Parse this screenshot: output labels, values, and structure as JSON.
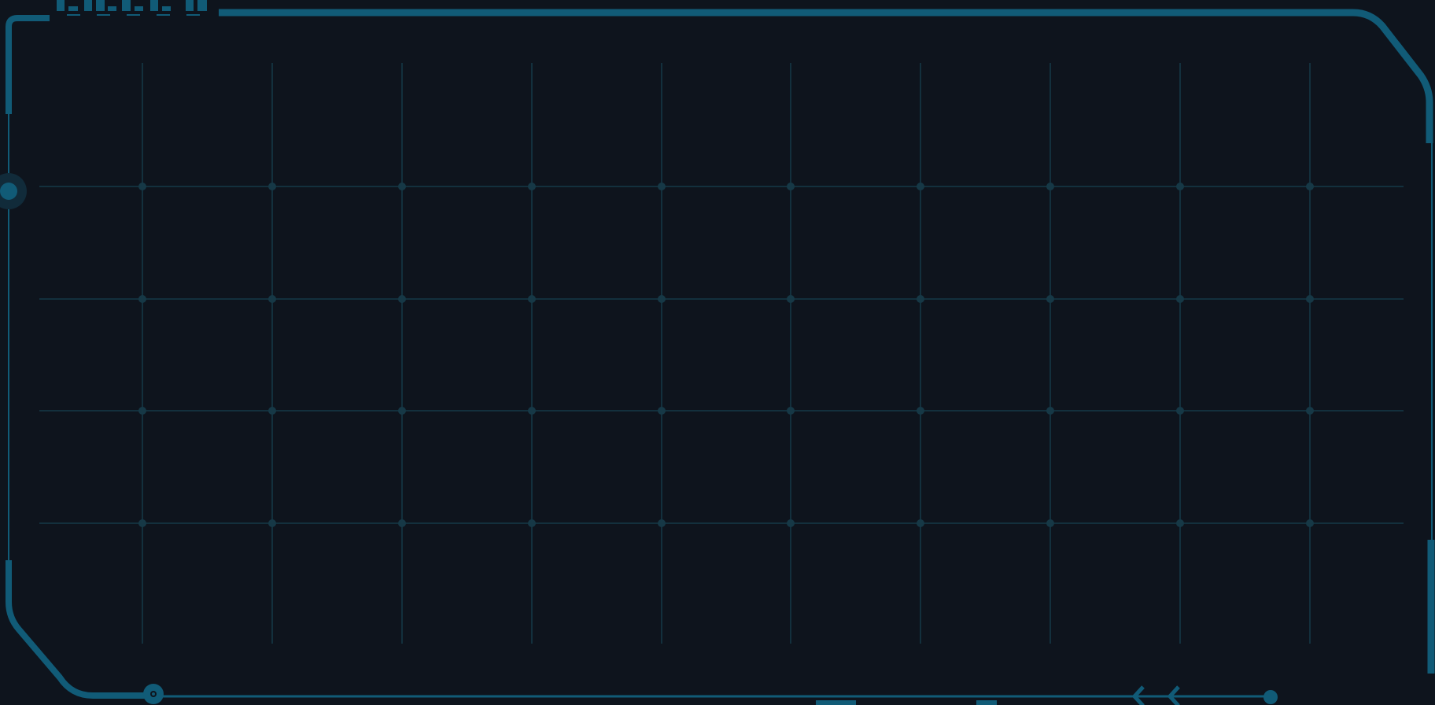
{
  "colors": {
    "background": "#0e141d",
    "frame_accent": "#115b77",
    "grid_line": "#13303d",
    "grid_node": "#163846"
  },
  "icons": {
    "top_left_tab": "bar-segments-icon",
    "left_side_node": "circle-node-icon",
    "bottom_left_node": "ring-node-icon",
    "bottom_right_chevrons": "double-chevron-left-icon",
    "bottom_right_node": "dot-node-icon"
  }
}
